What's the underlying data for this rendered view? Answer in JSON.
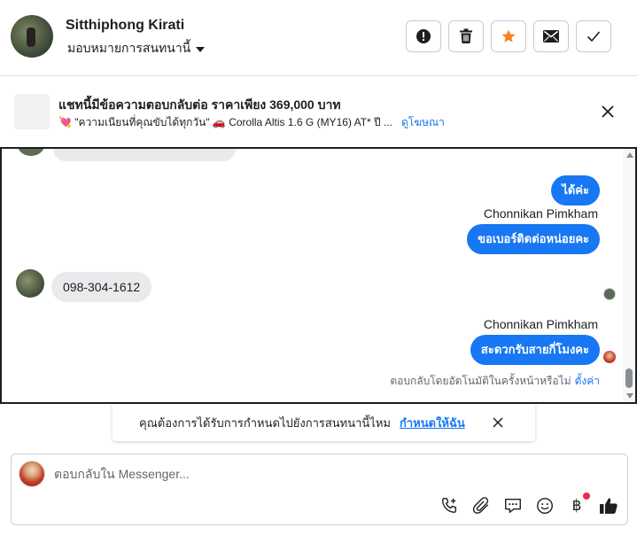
{
  "header": {
    "contact_name": "Sitthiphong Kirati",
    "assign_label": "มอบหมายการสนทนานี้",
    "actions": [
      {
        "name": "mark-spam",
        "icon": "alert-circle-icon"
      },
      {
        "name": "delete",
        "icon": "trash-icon"
      },
      {
        "name": "star",
        "icon": "star-icon",
        "color": "#f5821f"
      },
      {
        "name": "mark-unread",
        "icon": "envelope-icon"
      },
      {
        "name": "mark-done",
        "icon": "check-icon"
      }
    ]
  },
  "ad_banner": {
    "title": "แชทนี้มีข้อความตอบกลับต่อ ราคาเพียง 369,000 บาท",
    "subtitle": "💘 \"ความเนียนที่คุณขับได้ทุกวัน\" 🚗 Corolla Altis 1.6 G (MY16) AT* ปี ...",
    "link": "ดูโฆษณา"
  },
  "messages": [
    {
      "direction": "out",
      "text": "ได้ค่ะ"
    },
    {
      "direction": "out",
      "sender": "Chonnikan Pimkham",
      "text": "ขอเบอร์ติดต่อหน่อยคะ"
    },
    {
      "direction": "in",
      "text": "098-304-1612"
    },
    {
      "direction": "out",
      "sender": "Chonnikan Pimkham",
      "text": "สะดวกรับสายกี่โมงคะ"
    }
  ],
  "auto_reply": {
    "text": "ตอบกลับโดยอัตโนมัติในครั้งหน้าหรือไม่",
    "link": "ตั้งค่า"
  },
  "prompt": {
    "text": "คุณต้องการได้รับการกำหนดไปยังการสนทนานี้ไหม",
    "link": "กำหนดให้ฉัน"
  },
  "composer": {
    "placeholder": "ตอบกลับใน Messenger...",
    "tools": [
      "call-plus-icon",
      "paperclip-icon",
      "chat-bubble-icon",
      "emoji-icon",
      "baht-icon",
      "thumbs-up-icon"
    ],
    "baht_symbol": "฿"
  },
  "colors": {
    "accent": "#1877f2",
    "star": "#f5821f",
    "notification_dot": "#f02849"
  }
}
